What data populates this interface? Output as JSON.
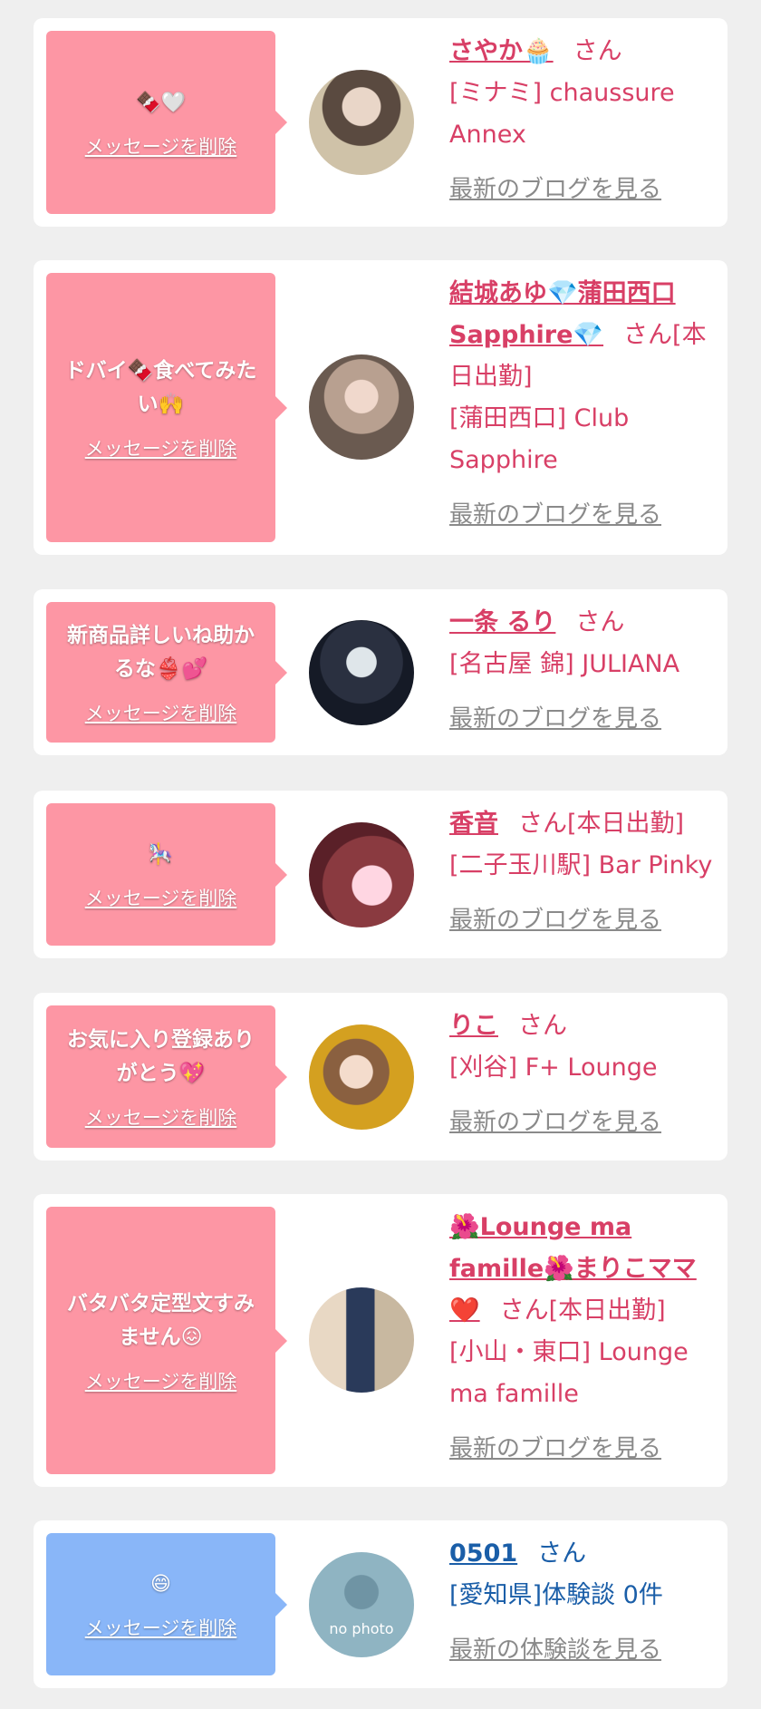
{
  "colors": {
    "background": "#efefef",
    "card": "#ffffff",
    "pink_bubble": "#fd96a4",
    "blue_bubble": "#89b6f8",
    "name_pink": "#d83f66",
    "name_blue": "#1a5ea8",
    "link_gray": "#8a8a8a"
  },
  "entries": [
    {
      "message": "🍫🤍",
      "delete_label": "メッセージを削除",
      "name": "さやか🧁",
      "honorific": "さん",
      "shop": "[ミナミ] chaussure Annex",
      "link": "最新のブログを見る",
      "bubble_color": "pink"
    },
    {
      "message": "ドバイ🍫食べてみたい🙌",
      "delete_label": "メッセージを削除",
      "name": "結城あゆ💎蒲田西口Sapphire💎",
      "honorific": "さん[本日出勤]",
      "shop": "[蒲田西口] Club Sapphire",
      "link": "最新のブログを見る",
      "bubble_color": "pink"
    },
    {
      "message": "新商品詳しいね助かるな👙💕",
      "delete_label": "メッセージを削除",
      "name": "一条 るり",
      "honorific": "さん",
      "shop": "[名古屋 錦] JULIANA",
      "link": "最新のブログを見る",
      "bubble_color": "pink"
    },
    {
      "message": "🎠",
      "delete_label": "メッセージを削除",
      "name": "香音",
      "honorific": "さん[本日出勤]",
      "shop": "[二子玉川駅] Bar Pinky",
      "link": "最新のブログを見る",
      "bubble_color": "pink"
    },
    {
      "message": "お気に入り登録ありがとう💖",
      "delete_label": "メッセージを削除",
      "name": "りこ",
      "honorific": "さん",
      "shop": "[刈谷] F+ Lounge",
      "link": "最新のブログを見る",
      "bubble_color": "pink"
    },
    {
      "message": "バタバタ定型文すみません😖",
      "delete_label": "メッセージを削除",
      "name": "🌺Lounge ma famille🌺まりこママ❤️",
      "honorific": "さん[本日出勤]",
      "shop": "[小山・東口] Lounge ma famille",
      "link": "最新のブログを見る",
      "bubble_color": "pink"
    },
    {
      "message": "😄",
      "delete_label": "メッセージを削除",
      "name": "0501",
      "honorific": "さん",
      "shop": "[愛知県]体験談 0件",
      "link": "最新の体験談を見る",
      "bubble_color": "blue",
      "avatar_text": "no photo"
    }
  ]
}
